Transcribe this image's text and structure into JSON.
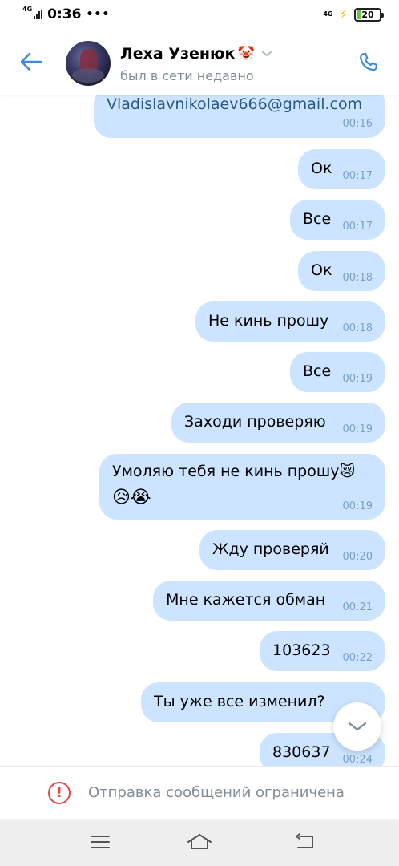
{
  "status_bar": {
    "network_left": "4G",
    "time": "0:36",
    "more": "•••",
    "network_right": "4G",
    "battery": "20"
  },
  "header": {
    "contact_name": "Леха Узенюк",
    "name_emoji": "🤡",
    "status": "был в сети недавно",
    "accent_color": "#3f8ae0"
  },
  "messages": [
    {
      "text": "Vladislavnikolaev666@gmail.com",
      "time": "00:16",
      "link": true
    },
    {
      "text": "Ок",
      "time": "00:17"
    },
    {
      "text": "Все",
      "time": "00:17"
    },
    {
      "text": "Ок",
      "time": "00:18"
    },
    {
      "text": "Не кинь прошу",
      "time": "00:18"
    },
    {
      "text": "Все",
      "time": "00:19"
    },
    {
      "text": "Заходи проверяю",
      "time": "00:19"
    },
    {
      "text": "Умоляю тебя не кинь прошу😿",
      "emoji_line": "😥😭",
      "time": "00:19"
    },
    {
      "text": "Жду проверяй",
      "time": "00:20"
    },
    {
      "text": "Мне кажется обман",
      "time": "00:21"
    },
    {
      "text": "103623",
      "time": "00:22"
    },
    {
      "text": "Ты уже все изменил?",
      "time": ""
    },
    {
      "text": "830637",
      "time": "00:24"
    }
  ],
  "restriction": {
    "icon": "!",
    "text": "Отправка сообщений ограничена"
  },
  "icons": {
    "back": "back-arrow-icon",
    "call": "phone-icon",
    "scroll": "chevron-down-icon",
    "nav_menu": "menu-icon",
    "nav_home": "home-icon",
    "nav_back": "return-icon"
  },
  "colors": {
    "bubble": "#cce4ff",
    "link": "#2a5885",
    "time": "#7aa0c5",
    "secondary_text": "#818c99",
    "error": "#e64646"
  }
}
